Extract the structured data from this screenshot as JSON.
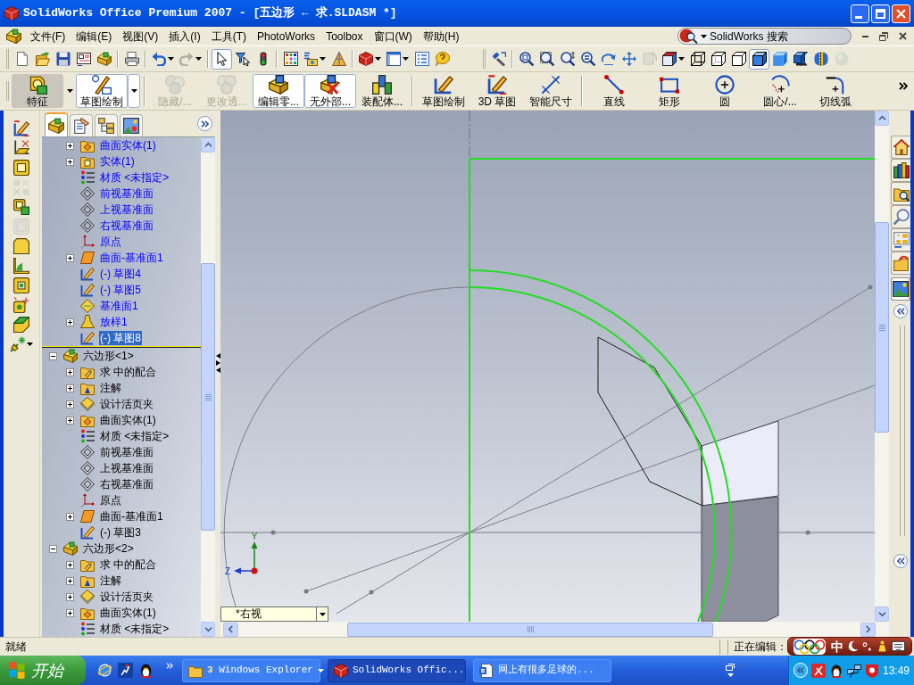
{
  "window": {
    "title": "SolidWorks Office Premium 2007 - [五边形 ← 求.SLDASM *]"
  },
  "menu_bar": {
    "items": [
      "文件(F)",
      "编辑(E)",
      "视图(V)",
      "插入(I)",
      "工具(T)",
      "PhotoWorks",
      "Toolbox",
      "窗口(W)",
      "帮助(H)"
    ],
    "search": {
      "placeholder": "SolidWorks 搜索"
    }
  },
  "standard_toolbar": {
    "groups": [
      [
        {
          "kind": "new",
          "pressed": false,
          "disabled": false,
          "dropdown": false
        },
        {
          "kind": "open",
          "pressed": false,
          "disabled": false,
          "dropdown": false
        },
        {
          "kind": "save",
          "pressed": false,
          "disabled": false,
          "dropdown": false
        },
        {
          "kind": "drawing",
          "pressed": false,
          "disabled": false,
          "dropdown": false
        },
        {
          "kind": "assembly",
          "pressed": false,
          "disabled": false,
          "dropdown": false
        }
      ],
      [
        {
          "kind": "print",
          "pressed": false,
          "disabled": false,
          "dropdown": false
        }
      ],
      [
        {
          "kind": "undo",
          "pressed": false,
          "disabled": false,
          "dropdown": true
        },
        {
          "kind": "redo",
          "pressed": false,
          "disabled": true,
          "dropdown": true
        }
      ],
      [
        {
          "kind": "select",
          "pressed": true,
          "disabled": false,
          "dropdown": false
        },
        {
          "kind": "filter",
          "pressed": false,
          "disabled": false,
          "dropdown": false
        },
        {
          "kind": "rebuild",
          "pressed": false,
          "disabled": false,
          "dropdown": false
        }
      ],
      [
        {
          "kind": "options",
          "pressed": false,
          "disabled": false,
          "dropdown": false
        },
        {
          "kind": "equation",
          "pressed": false,
          "disabled": false,
          "dropdown": true
        },
        {
          "kind": "render",
          "pressed": false,
          "disabled": false,
          "dropdown": false
        }
      ],
      [
        {
          "kind": "sw",
          "pressed": false,
          "disabled": false,
          "dropdown": true
        },
        {
          "kind": "window",
          "pressed": false,
          "disabled": false,
          "dropdown": true
        },
        {
          "kind": "list",
          "pressed": false,
          "disabled": false,
          "dropdown": false
        },
        {
          "kind": "help",
          "pressed": false,
          "disabled": false,
          "dropdown": false
        }
      ]
    ]
  },
  "view_toolbar": {
    "groups": [
      [
        {
          "kind": "prev_view",
          "pressed": false,
          "disabled": false,
          "dropdown": false
        }
      ],
      [
        {
          "kind": "zoom_fit",
          "pressed": false,
          "disabled": false,
          "dropdown": false
        },
        {
          "kind": "zoom_area",
          "pressed": false,
          "disabled": false,
          "dropdown": false
        },
        {
          "kind": "zoom_inout",
          "pressed": false,
          "disabled": false,
          "dropdown": false
        },
        {
          "kind": "zoom_sel",
          "pressed": false,
          "disabled": false,
          "dropdown": false
        },
        {
          "kind": "rotate",
          "pressed": false,
          "disabled": false,
          "dropdown": false
        },
        {
          "kind": "pan",
          "pressed": false,
          "disabled": false,
          "dropdown": false
        },
        {
          "kind": "roll",
          "pressed": false,
          "disabled": true,
          "dropdown": false
        },
        {
          "kind": "view_orient",
          "pressed": false,
          "disabled": false,
          "dropdown": true
        },
        {
          "kind": "wireframe",
          "pressed": false,
          "disabled": false,
          "dropdown": false
        },
        {
          "kind": "hidden_gray",
          "pressed": false,
          "disabled": false,
          "dropdown": false
        },
        {
          "kind": "hidden_removed",
          "pressed": false,
          "disabled": false,
          "dropdown": false
        },
        {
          "kind": "shaded_edges",
          "pressed": true,
          "disabled": false,
          "dropdown": false
        },
        {
          "kind": "shaded",
          "pressed": false,
          "disabled": false,
          "dropdown": false
        },
        {
          "kind": "shadow",
          "pressed": false,
          "disabled": false,
          "dropdown": false
        },
        {
          "kind": "section",
          "pressed": false,
          "disabled": false,
          "dropdown": false
        },
        {
          "kind": "realview",
          "pressed": false,
          "disabled": true,
          "dropdown": false
        }
      ]
    ]
  },
  "command_manager": {
    "groups": [
      [
        {
          "label": "特征",
          "kind": "features",
          "highlighted": true,
          "pressed": false,
          "disabled": false,
          "dropdown": true
        },
        {
          "label": "草图绘制",
          "kind": "sketch_tab",
          "highlighted": false,
          "pressed": true,
          "disabled": false,
          "dropdown": true
        }
      ],
      [
        {
          "label": "隐藏/...",
          "kind": "hide_show",
          "highlighted": false,
          "pressed": false,
          "disabled": true,
          "dropdown": false
        },
        {
          "label": "更改透...",
          "kind": "transparency",
          "highlighted": false,
          "pressed": false,
          "disabled": true,
          "dropdown": false
        },
        {
          "label": "编辑零...",
          "kind": "edit_part",
          "highlighted": false,
          "pressed": true,
          "disabled": false,
          "dropdown": false
        },
        {
          "label": "无外部...",
          "kind": "no_external",
          "highlighted": false,
          "pressed": true,
          "disabled": false,
          "dropdown": false
        },
        {
          "label": "装配体...",
          "kind": "assembly_layout",
          "highlighted": false,
          "pressed": false,
          "disabled": false,
          "dropdown": false
        }
      ],
      [
        {
          "label": "草图绘制",
          "kind": "sketch",
          "highlighted": false,
          "pressed": false,
          "disabled": false,
          "dropdown": false
        },
        {
          "label": "3D 草图",
          "kind": "sketch3d",
          "highlighted": false,
          "pressed": false,
          "disabled": false,
          "dropdown": false
        },
        {
          "label": "智能尺寸",
          "kind": "smart_dimension",
          "highlighted": false,
          "pressed": false,
          "disabled": false,
          "dropdown": false
        }
      ],
      [
        {
          "label": "直线",
          "kind": "line",
          "highlighted": false,
          "pressed": false,
          "disabled": false,
          "dropdown": false
        },
        {
          "label": "矩形",
          "kind": "rectangle",
          "highlighted": false,
          "pressed": false,
          "disabled": false,
          "dropdown": false
        },
        {
          "label": "圆",
          "kind": "circle",
          "highlighted": false,
          "pressed": false,
          "disabled": false,
          "dropdown": false
        },
        {
          "label": "圆心/...",
          "kind": "center_arc",
          "highlighted": false,
          "pressed": false,
          "disabled": false,
          "dropdown": false
        },
        {
          "label": "切线弧",
          "kind": "tangent_arc",
          "highlighted": false,
          "pressed": false,
          "disabled": false,
          "dropdown": false
        }
      ]
    ]
  },
  "left_toolbar": {
    "buttons": [
      {
        "kind": "sketch3d",
        "disabled": false,
        "dropdown": false
      },
      {
        "kind": "plane",
        "disabled": false,
        "dropdown": false
      },
      {
        "kind": "box",
        "disabled": false,
        "dropdown": false
      },
      {
        "kind": "pattern",
        "disabled": true,
        "dropdown": false
      },
      {
        "kind": "cube_green",
        "disabled": false,
        "dropdown": false
      },
      {
        "kind": "shell",
        "disabled": true,
        "dropdown": false
      },
      {
        "kind": "block",
        "disabled": false,
        "dropdown": false
      },
      {
        "kind": "angle",
        "disabled": false,
        "dropdown": false
      },
      {
        "kind": "frame",
        "disabled": false,
        "dropdown": false
      },
      {
        "kind": "spark_box",
        "disabled": false,
        "dropdown": false
      },
      {
        "kind": "green_block",
        "disabled": false,
        "dropdown": false
      },
      {
        "kind": "spark",
        "disabled": false,
        "dropdown": true
      }
    ]
  },
  "feature_tree": {
    "tabs": [
      {
        "kind": "feature_manager",
        "selected": true
      },
      {
        "kind": "property_manager",
        "selected": false
      },
      {
        "kind": "configuration_manager",
        "selected": false
      },
      {
        "kind": "display_manager",
        "selected": false
      }
    ],
    "scrolled_branch": {
      "editing": true,
      "items": [
        {
          "label": "曲面实体(1)",
          "kind": "surface_bodies",
          "expanded": false,
          "selected": false
        },
        {
          "label": "实体(1)",
          "kind": "solid_bodies",
          "expanded": false,
          "selected": false
        },
        {
          "label": "材质 <未指定>",
          "kind": "material",
          "selected": false
        },
        {
          "label": "前视基准面",
          "kind": "plane",
          "selected": false
        },
        {
          "label": "上视基准面",
          "kind": "plane",
          "selected": false
        },
        {
          "label": "右视基准面",
          "kind": "plane",
          "selected": false
        },
        {
          "label": "原点",
          "kind": "origin",
          "selected": false
        },
        {
          "label": "曲面-基准面1",
          "kind": "surface_plane",
          "expanded": false,
          "selected": false
        },
        {
          "label": "(-) 草图4",
          "kind": "sketch",
          "selected": false
        },
        {
          "label": "(-) 草图5",
          "kind": "sketch",
          "selected": false
        },
        {
          "label": "基准面1",
          "kind": "ref_plane",
          "selected": false
        },
        {
          "label": "放样1",
          "kind": "loft",
          "expanded": false,
          "selected": false
        },
        {
          "label": "(-) 草图8",
          "kind": "sketch",
          "selected": true
        }
      ]
    },
    "nodes": [
      {
        "label": "六边形<1>",
        "kind": "part",
        "expanded": true,
        "selected": false,
        "children": [
          {
            "label": "求 中的配合",
            "kind": "mates",
            "expanded": false,
            "selected": false
          },
          {
            "label": "注解",
            "kind": "annotations",
            "expanded": false,
            "selected": false
          },
          {
            "label": "设计活页夹",
            "kind": "design_binder",
            "expanded": false,
            "selected": false
          },
          {
            "label": "曲面实体(1)",
            "kind": "surface_bodies",
            "expanded": false,
            "selected": false
          },
          {
            "label": "材质 <未指定>",
            "kind": "material",
            "selected": false
          },
          {
            "label": "前视基准面",
            "kind": "plane",
            "selected": false
          },
          {
            "label": "上视基准面",
            "kind": "plane",
            "selected": false
          },
          {
            "label": "右视基准面",
            "kind": "plane",
            "selected": false
          },
          {
            "label": "原点",
            "kind": "origin",
            "selected": false
          },
          {
            "label": "曲面-基准面1",
            "kind": "surface_plane",
            "expanded": false,
            "selected": false
          },
          {
            "label": "(-) 草图3",
            "kind": "sketch",
            "selected": false
          }
        ]
      },
      {
        "label": "六边形<2>",
        "kind": "part",
        "expanded": true,
        "selected": false,
        "children": [
          {
            "label": "求 中的配合",
            "kind": "mates",
            "expanded": false,
            "selected": false
          },
          {
            "label": "注解",
            "kind": "annotations",
            "expanded": false,
            "selected": false
          },
          {
            "label": "设计活页夹",
            "kind": "design_binder",
            "expanded": false,
            "selected": false
          },
          {
            "label": "曲面实体(1)",
            "kind": "surface_bodies",
            "expanded": false,
            "selected": false
          },
          {
            "label": "材质 <未指定>",
            "kind": "material",
            "selected": false
          }
        ]
      }
    ]
  },
  "graphics_area": {
    "triad": {
      "y_label": "Y",
      "z_label": "Z"
    },
    "view_selector": {
      "value": "*右视"
    }
  },
  "task_pane": {
    "tabs": [
      {
        "kind": "home",
        "selected": false
      },
      {
        "kind": "library",
        "selected": false
      },
      {
        "kind": "file_explorer",
        "selected": false
      },
      {
        "kind": "search",
        "selected": false
      },
      {
        "kind": "view_palette",
        "selected": false
      },
      {
        "kind": "file_open",
        "selected": false
      },
      {
        "kind": "appearance",
        "selected": true
      }
    ]
  },
  "status_bar": {
    "message": "就绪",
    "editing_label": "正在编辑："
  },
  "ime_bar": {
    "mode": "中"
  },
  "taskbar": {
    "start": "开始",
    "tasks": [
      {
        "label": "**3** Windows Explorer",
        "kind": "folder_group",
        "selected": false
      },
      {
        "label": "SolidWorks Offic...",
        "kind": "solidworks",
        "selected": true
      },
      {
        "label": "网上有很多足球的...",
        "kind": "document",
        "selected": false
      }
    ],
    "clock": "13:49"
  }
}
